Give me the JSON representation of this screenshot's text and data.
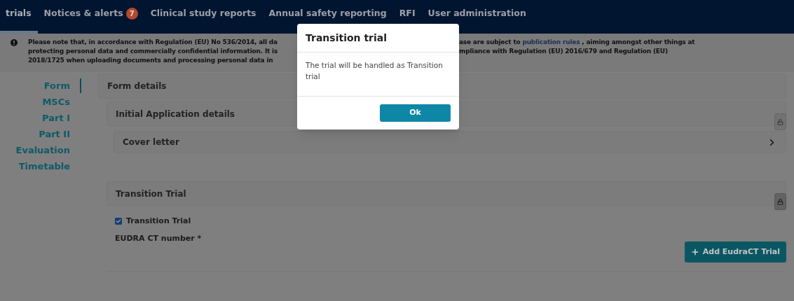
{
  "nav": {
    "tabs": [
      {
        "label": "trials",
        "selected": true
      },
      {
        "label": "Notices & alerts",
        "badge": "7",
        "selected": false
      },
      {
        "label": "Clinical study reports",
        "selected": false
      },
      {
        "label": "Annual safety reporting",
        "selected": false
      },
      {
        "label": "RFI",
        "selected": false
      },
      {
        "label": "User administration",
        "selected": false
      }
    ]
  },
  "notice": {
    "left_lines": [
      "Please note that, in accordance with Regulation (EU) No 536/2014, all da",
      "protecting personal data and commercially confidential information. It is",
      "2018/1725 when uploading documents and processing personal data in"
    ],
    "right_line_1": {
      "before": "ase are subject to ",
      "link": "publication rules",
      "after": " , aiming amongst other things at"
    },
    "right_line_2": "mpliance with Regulation (EU) 2016/679 and Regulation (EU)"
  },
  "sidebar": {
    "items": [
      {
        "label": "Form",
        "selected": true
      },
      {
        "label": "MSCs",
        "selected": false
      },
      {
        "label": "Part I",
        "selected": false
      },
      {
        "label": "Part II",
        "selected": false
      },
      {
        "label": "Evaluation",
        "selected": false
      },
      {
        "label": "Timetable",
        "selected": false
      }
    ]
  },
  "form": {
    "title": "Form details",
    "initial": {
      "title": "Initial Application details",
      "locked": false,
      "cover_letter": "Cover letter"
    },
    "transition": {
      "title": "Transition Trial",
      "locked": true,
      "checkbox": {
        "label": "Transition Trial",
        "checked": true
      },
      "eudra_label": "EUDRA CT number *",
      "add_button": "Add EudraCT Trial"
    }
  },
  "modal": {
    "title": "Transition trial",
    "message": "The trial will be handled as Transition trial",
    "button": "Ok"
  }
}
